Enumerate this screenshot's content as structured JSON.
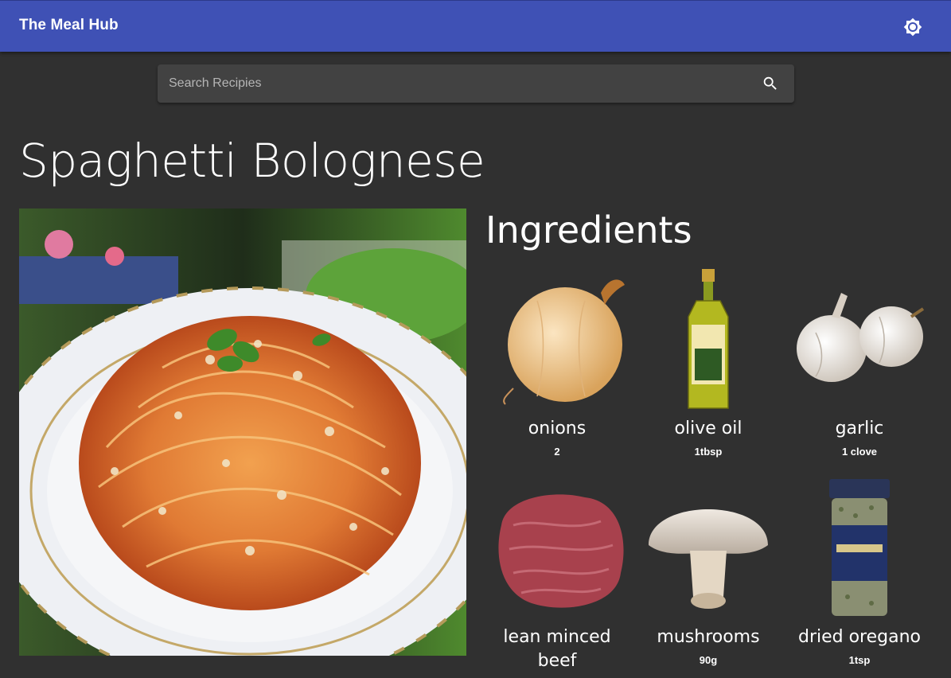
{
  "app": {
    "title": "The Meal Hub",
    "theme_icon": "brightness-icon",
    "accent_color": "#3f51b5"
  },
  "search": {
    "placeholder": "Search Recipies",
    "value": "",
    "icon": "search-icon"
  },
  "recipe": {
    "title": "Spaghetti Bolognese",
    "image_description_icon": "recipe-photo"
  },
  "ingredients": {
    "heading": "Ingredients",
    "items": [
      {
        "name": "onions",
        "measure": "2",
        "icon": "onion-icon"
      },
      {
        "name": "olive oil",
        "measure": "1tbsp",
        "icon": "olive-oil-icon"
      },
      {
        "name": "garlic",
        "measure": "1 clove",
        "icon": "garlic-icon"
      },
      {
        "name": "lean minced beef",
        "measure": "",
        "icon": "minced-beef-icon"
      },
      {
        "name": "mushrooms",
        "measure": "90g",
        "icon": "mushroom-icon"
      },
      {
        "name": "dried oregano",
        "measure": "1tsp",
        "icon": "oregano-icon"
      }
    ]
  }
}
